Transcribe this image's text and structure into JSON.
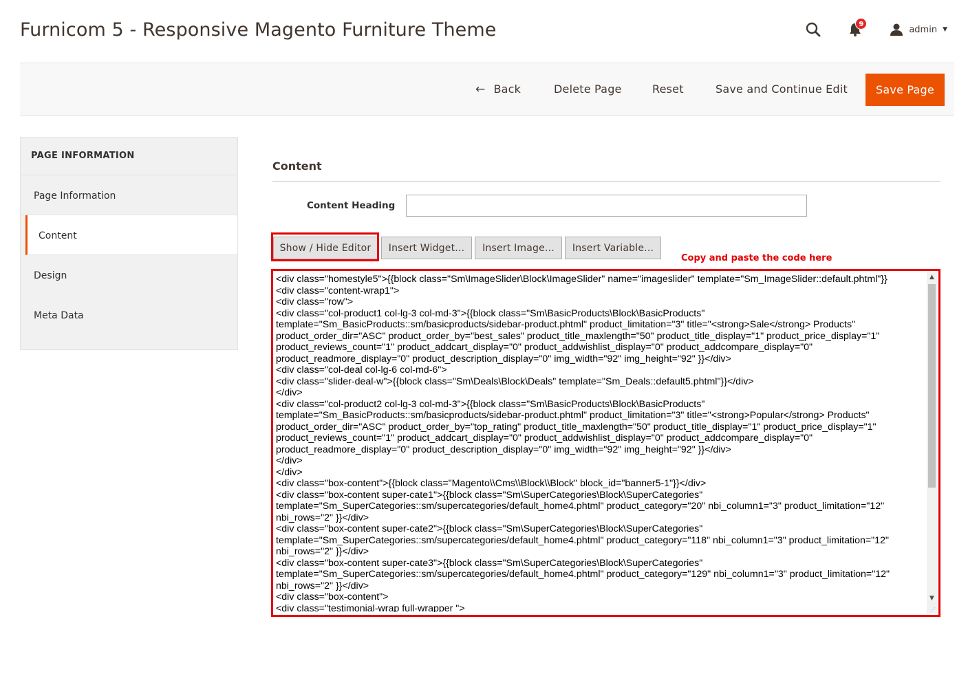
{
  "header": {
    "title": "Furnicom 5 - Responsive Magento Furniture Theme",
    "notifications_count": "9",
    "user_name": "admin",
    "icons": [
      "search-icon",
      "bell-icon",
      "user-icon",
      "caret-down-icon"
    ]
  },
  "toolbar": {
    "back_label": "Back",
    "delete_label": "Delete Page",
    "reset_label": "Reset",
    "save_continue_label": "Save and Continue Edit",
    "save_label": "Save Page",
    "accent_color": "#eb5202"
  },
  "sidebar": {
    "heading": "PAGE INFORMATION",
    "items": [
      {
        "label": "Page Information",
        "active": false
      },
      {
        "label": "Content",
        "active": true
      },
      {
        "label": "Design",
        "active": false
      },
      {
        "label": "Meta Data",
        "active": false
      }
    ]
  },
  "content": {
    "section_title": "Content",
    "heading_label": "Content Heading",
    "heading_value": "",
    "buttons": {
      "show_hide": "Show / Hide Editor",
      "insert_widget": "Insert Widget...",
      "insert_image": "Insert Image...",
      "insert_variable": "Insert Variable..."
    },
    "annotation": "Copy and paste the code here",
    "annotation_color": "#e50000",
    "code_lines": [
      "<div class=\"homestyle5\">{{block class=\"Sm\\ImageSlider\\Block\\ImageSlider\" name=\"imageslider\" template=\"Sm_ImageSlider::default.phtml\"}}",
      "<div class=\"content-wrap1\">",
      "<div class=\"row\">",
      "<div class=\"col-product1 col-lg-3 col-md-3\">{{block class=\"Sm\\BasicProducts\\Block\\BasicProducts\"",
      "template=\"Sm_BasicProducts::sm/basicproducts/sidebar-product.phtml\" product_limitation=\"3\" title=\"<strong>Sale</strong> Products\"",
      "product_order_dir=\"ASC\" product_order_by=\"best_sales\" product_title_maxlength=\"50\" product_title_display=\"1\" product_price_display=\"1\"",
      "product_reviews_count=\"1\" product_addcart_display=\"0\" product_addwishlist_display=\"0\" product_addcompare_display=\"0\"",
      "product_readmore_display=\"0\" product_description_display=\"0\" img_width=\"92\" img_height=\"92\" }}</div>",
      "<div class=\"col-deal col-lg-6 col-md-6\">",
      "<div class=\"slider-deal-w\">{{block class=\"Sm\\Deals\\Block\\Deals\" template=\"Sm_Deals::default5.phtml\"}}</div>",
      "</div>",
      "<div class=\"col-product2 col-lg-3 col-md-3\">{{block class=\"Sm\\BasicProducts\\Block\\BasicProducts\"",
      "template=\"Sm_BasicProducts::sm/basicproducts/sidebar-product.phtml\" product_limitation=\"3\" title=\"<strong>Popular</strong> Products\"",
      "product_order_dir=\"ASC\" product_order_by=\"top_rating\" product_title_maxlength=\"50\" product_title_display=\"1\" product_price_display=\"1\"",
      "product_reviews_count=\"1\" product_addcart_display=\"0\" product_addwishlist_display=\"0\" product_addcompare_display=\"0\"",
      "product_readmore_display=\"0\" product_description_display=\"0\" img_width=\"92\" img_height=\"92\" }}</div>",
      "</div>",
      "</div>",
      "<div class=\"box-content\">{{block class=\"Magento\\\\Cms\\\\Block\\\\Block\" block_id=\"banner5-1\"}}</div>",
      "<div class=\"box-content super-cate1\">{{block class=\"Sm\\SuperCategories\\Block\\SuperCategories\"",
      "template=\"Sm_SuperCategories::sm/supercategories/default_home4.phtml\" product_category=\"20\" nbi_column1=\"3\" product_limitation=\"12\"",
      "nbi_rows=\"2\" }}</div>",
      "<div class=\"box-content super-cate2\">{{block class=\"Sm\\SuperCategories\\Block\\SuperCategories\"",
      "template=\"Sm_SuperCategories::sm/supercategories/default_home4.phtml\" product_category=\"118\" nbi_column1=\"3\" product_limitation=\"12\"",
      "nbi_rows=\"2\" }}</div>",
      "<div class=\"box-content super-cate3\">{{block class=\"Sm\\SuperCategories\\Block\\SuperCategories\"",
      "template=\"Sm_SuperCategories::sm/supercategories/default_home4.phtml\" product_category=\"129\" nbi_column1=\"3\" product_limitation=\"12\"",
      "nbi_rows=\"2\" }}</div>",
      "<div class=\"box-content\">",
      "<div class=\"testimonial-wrap full-wrapper \">"
    ]
  }
}
